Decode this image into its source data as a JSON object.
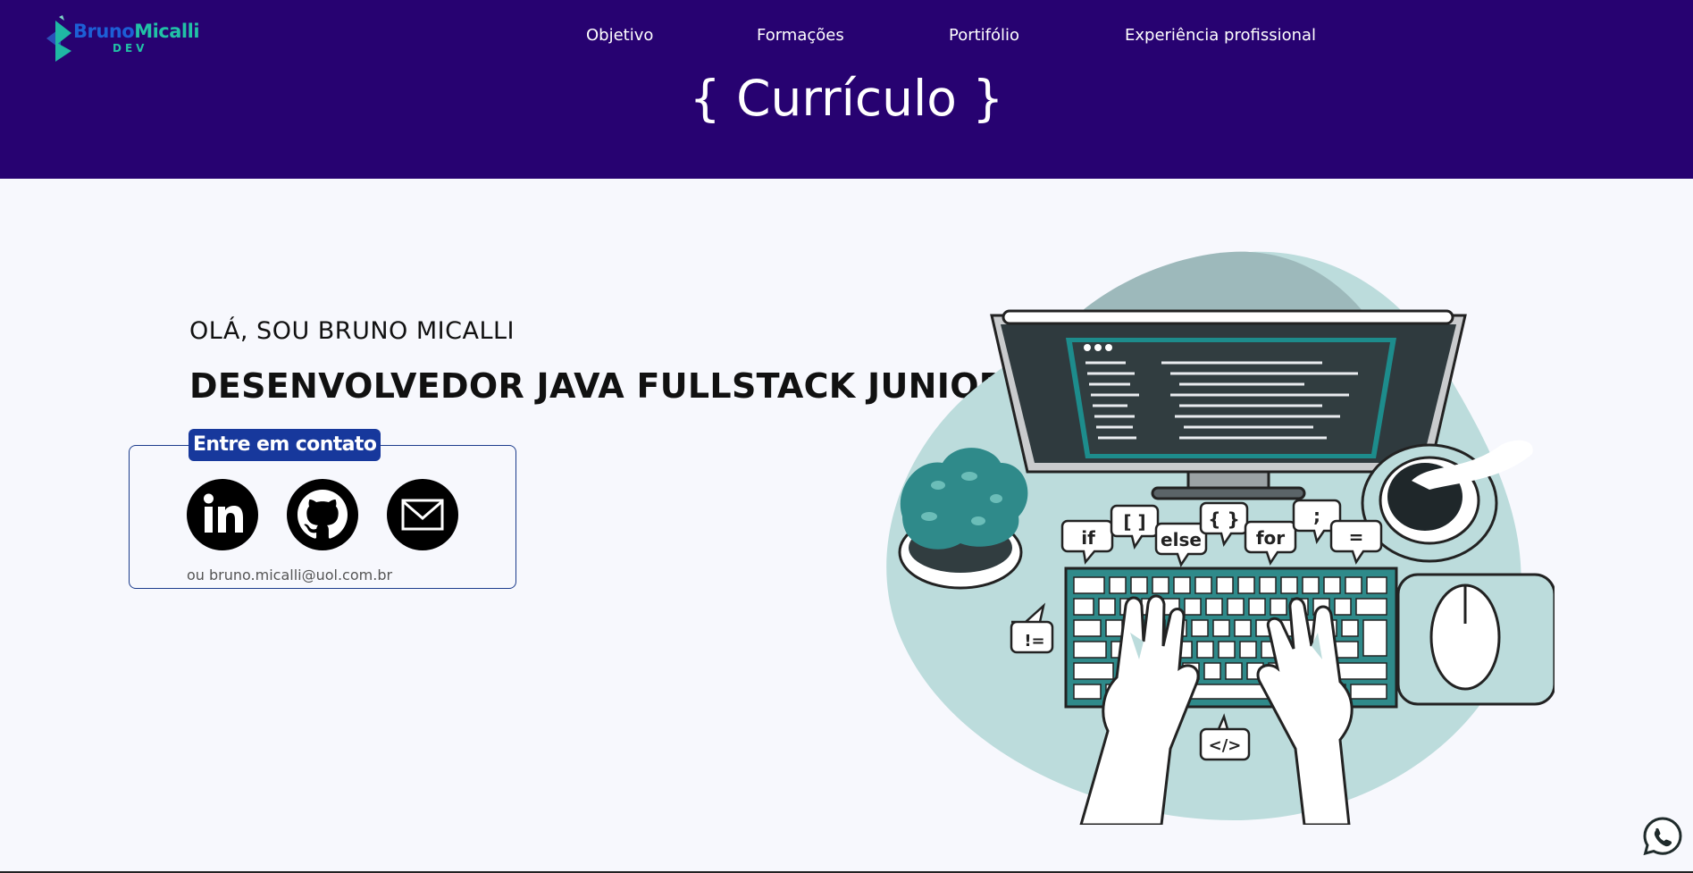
{
  "logo": {
    "brand_first": "Bruno",
    "brand_last": "Micalli",
    "sub": "DEV"
  },
  "nav": {
    "items": [
      {
        "label": "Objetivo"
      },
      {
        "label": "Formações"
      },
      {
        "label": "Portifólio"
      },
      {
        "label": "Experiência profissional"
      }
    ]
  },
  "page_title": "{ Currículo }",
  "hero": {
    "greeting": "OLÁ, SOU BRUNO MICALLI",
    "headline": "DESENVOLVEDOR JAVA FULLSTACK JUNIOR"
  },
  "contact": {
    "badge": "Entre em contato",
    "email_text": "ou bruno.micalli@uol.com.br",
    "links": [
      {
        "icon": "linkedin-icon"
      },
      {
        "icon": "github-icon"
      },
      {
        "icon": "mail-icon"
      }
    ]
  },
  "illustration": {
    "bubbles": [
      "if",
      "[ ]",
      "else",
      "{ }",
      "for",
      ";",
      "=",
      "!=",
      "</>"
    ]
  },
  "colors": {
    "header_bg": "#270271",
    "page_bg": "#f7f8fd",
    "badge_bg": "#17389c",
    "accent_teal": "#2f8a8a",
    "blob": "#bcdcdc"
  }
}
